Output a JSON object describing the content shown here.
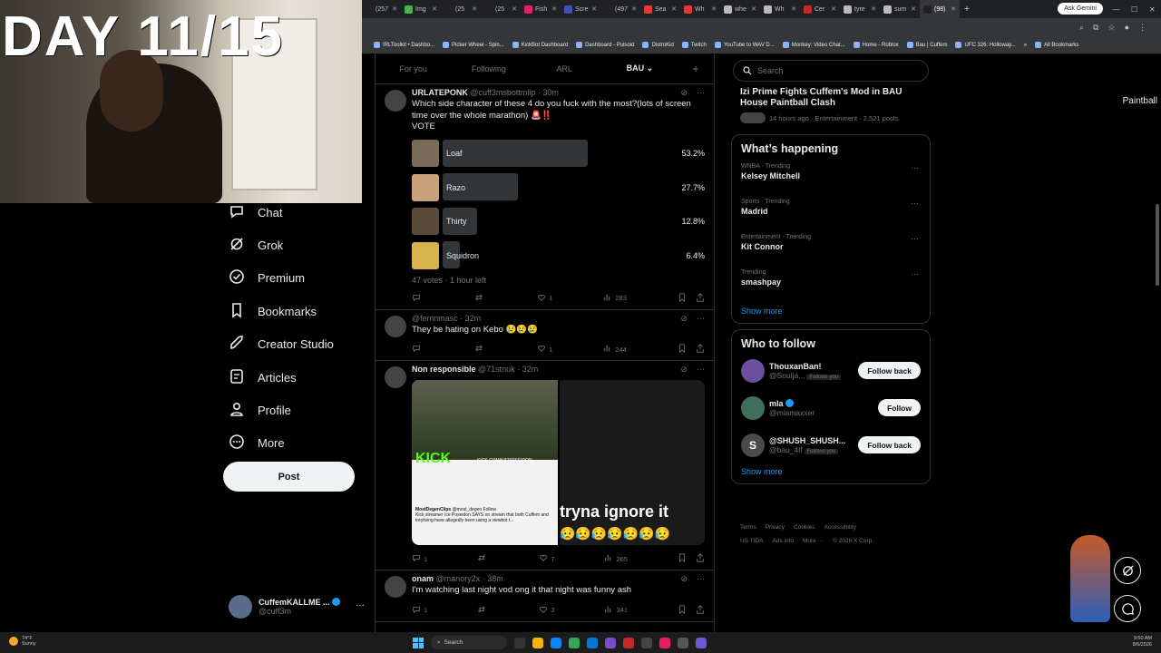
{
  "stream": {
    "day_title": "DAY 11/15"
  },
  "browser": {
    "tabs": [
      {
        "label": "(257",
        "icon_color": "#222"
      },
      {
        "label": "Img",
        "icon_color": "#4caf50"
      },
      {
        "label": "(25",
        "icon_color": "#222"
      },
      {
        "label": "(25",
        "icon_color": "#222"
      },
      {
        "label": "Fish",
        "icon_color": "#e91e63"
      },
      {
        "label": "Scre",
        "icon_color": "#3f51b5"
      },
      {
        "label": "(497",
        "icon_color": "#222"
      },
      {
        "label": "Sea",
        "icon_color": "#e53935"
      },
      {
        "label": "Wh",
        "icon_color": "#e53935"
      },
      {
        "label": "whe",
        "icon_color": "#bbb"
      },
      {
        "label": "Wh",
        "icon_color": "#bbb"
      },
      {
        "label": "Cer",
        "icon_color": "#c62828"
      },
      {
        "label": "tyre",
        "icon_color": "#bbb"
      },
      {
        "label": "sum",
        "icon_color": "#bbb"
      },
      {
        "label": "(98)",
        "icon_color": "#222"
      }
    ],
    "new_tab": "+",
    "gemini_label": "Ask Gemini",
    "bookmarks": [
      "IRLToolkit • Dashbo...",
      "Picker Wheel - Spin...",
      "KickBot Dashboard",
      "Dashboard - Pulsoid",
      "DistroKid",
      "Twitch",
      "YouTube to WAV D...",
      "Monkey: Video Chat...",
      "Home - Roblox",
      "Bau | Cuffem",
      "UFC 326: Holloway..."
    ],
    "all_bookmarks": "All Bookmarks",
    "bookmarks_overflow": "»"
  },
  "nav": {
    "items": [
      {
        "label": "Chat",
        "icon": "chat-icon"
      },
      {
        "label": "Grok",
        "icon": "grok-icon"
      },
      {
        "label": "Premium",
        "icon": "premium-icon"
      },
      {
        "label": "Bookmarks",
        "icon": "bookmark-icon"
      },
      {
        "label": "Creator Studio",
        "icon": "rocket-icon"
      },
      {
        "label": "Articles",
        "icon": "article-icon"
      },
      {
        "label": "Profile",
        "icon": "profile-icon"
      },
      {
        "label": "More",
        "icon": "more-circle-icon"
      }
    ],
    "post_label": "Post",
    "account": {
      "name": "CuffemKALLME ...",
      "handle": "@cuff3m",
      "more": "···"
    }
  },
  "feed": {
    "tabs": [
      "For you",
      "Following",
      "ARL",
      "BAU"
    ],
    "active_tab": "BAU",
    "add": "+",
    "tweets": [
      {
        "name": "URLATEPONK",
        "handle": "@cuff3msbottmlip",
        "time": "· 30m",
        "text": "Which side character of these 4 do you fuck with the most?(lots of screen time over the whole marathon) 🚨‼️",
        "text2": "VOTE",
        "poll": [
          {
            "label": "Loaf",
            "pct": "53.2%",
            "value": 53.2
          },
          {
            "label": "Razo",
            "pct": "27.7%",
            "value": 27.7
          },
          {
            "label": "Thirty",
            "pct": "12.8%",
            "value": 12.8
          },
          {
            "label": "Squidron",
            "pct": "6.4%",
            "value": 6.4
          }
        ],
        "poll_meta": "47 votes · 1 hour left",
        "replies": "",
        "reposts": "",
        "likes": "1",
        "views": "283"
      },
      {
        "name": "",
        "handle": "@femnmasc",
        "time": "· 32m",
        "text": "They be hating on Kebo 😢😢😢",
        "replies": "",
        "reposts": "",
        "likes": "1",
        "views": "244"
      },
      {
        "name": "Non responsible",
        "handle": "@71stnuk",
        "time": "· 32m",
        "media_kick": "KICK",
        "media_url": "KICK.COM/KIEPOSEIDON",
        "media_card_user": "MostDegenClips",
        "media_card_handle": "@most_degen",
        "media_card_follow": "Follow",
        "media_card_text": "Kick streamer Ice Poseidon SAYS on stream that both Cuffem and treyliving have allegedly been using a viewbot t...",
        "media_caption": "tryna ignore it",
        "media_emojis": "😥😥😥😥😥😥😥",
        "replies": "1",
        "reposts": "",
        "likes": "7",
        "views": "265"
      },
      {
        "name": "onam",
        "handle": "@manory2x",
        "time": "· 38m",
        "text": "I'm watching last night vod ong it that night was funny ash",
        "replies": "1",
        "reposts": "",
        "likes": "3",
        "views": "341"
      }
    ]
  },
  "sidebar": {
    "search_placeholder": "Search",
    "live": {
      "title": "Izi Prime Fights Cuffem's Mod in BAU House Paintball Clash",
      "meta": "14 hours ago · Entertainment · 2,521 posts"
    },
    "happening_title": "What’s happening",
    "trends": [
      {
        "context": "WNBA · Trending",
        "name": "Kelsey Mitchell"
      },
      {
        "context": "Sports · Trending",
        "name": "Madrid"
      },
      {
        "context": "Entertainment · Trending",
        "name": "Kit Connor"
      },
      {
        "context": "Trending",
        "name": "smashpay"
      }
    ],
    "show_more": "Show more",
    "follow_title": "Who to follow",
    "follow": [
      {
        "name": "ThouxanBan!",
        "handle": "@Soulja...",
        "follows_you": "Follows you",
        "button": "Follow back",
        "av_color": "#6d4fa0"
      },
      {
        "name": "mla",
        "handle": "@miamaxxer",
        "follows_you": "",
        "button": "Follow",
        "av_color": "#3f6e5a"
      },
      {
        "name": "@SHUSH_SHUSH...",
        "handle": "@bau_4lf",
        "follows_you": "Follows you",
        "button": "Follow back",
        "av_color": "#4a4a4a",
        "initial": "S"
      }
    ],
    "footer": [
      "Terms",
      "Privacy",
      "Cookies",
      "Accessibility",
      "US TIDA",
      "Ads info",
      "More ···",
      "© 2026 X Corp."
    ]
  },
  "overlay": {
    "paintball": "Paintball"
  },
  "taskbar": {
    "weather_temp": "74°F",
    "weather_desc": "Sunny",
    "search": "Search",
    "time": "9:50 AM",
    "date": "8/6/2026"
  }
}
